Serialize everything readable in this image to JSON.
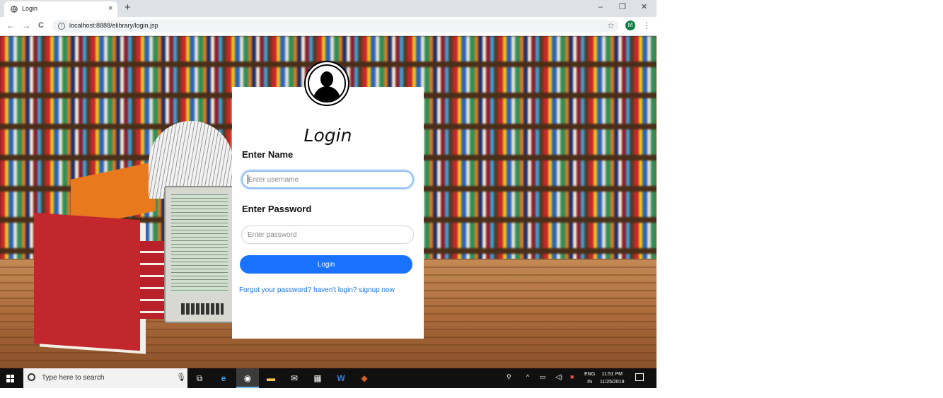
{
  "browser": {
    "tab_title": "Login",
    "tab_close": "×",
    "new_tab": "+",
    "window_minimize": "–",
    "window_restore": "❐",
    "window_close": "✕",
    "back": "←",
    "forward": "→",
    "reload": "C",
    "url": "localhost:8888/elibrary/login.jsp",
    "bookmark_star": "☆",
    "profile_initial": "M",
    "menu": "⋮"
  },
  "login": {
    "title": "Login",
    "name_label": "Enter Name",
    "name_placeholder": "Enter username",
    "password_label": "Enter Password",
    "password_placeholder": "Enter password",
    "submit_label": "Login",
    "forgot_link": "Forgot your password?",
    "signup_prompt": "haven't login?",
    "signup_link": "signup now"
  },
  "taskbar": {
    "search_placeholder": "Type here to search",
    "language_top": "ENG",
    "language_bottom": "IN",
    "time": "11:51 PM",
    "date": "11/25/2019"
  },
  "colors": {
    "primary": "#1a73ff",
    "link": "#1a73e8",
    "focus_ring": "#8fbff0"
  }
}
